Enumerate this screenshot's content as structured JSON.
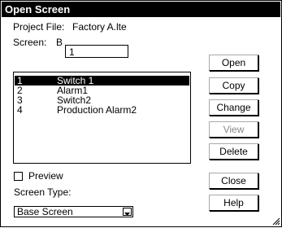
{
  "dialog": {
    "title": "Open Screen",
    "project_file_label": "Project File:",
    "project_file_value": "Factory A.lte",
    "screen_label": "Screen:",
    "screen_prefix": "B",
    "screen_value": "1",
    "screens": [
      {
        "number": "1",
        "name": "Switch 1",
        "selected": true
      },
      {
        "number": "2",
        "name": "Alarm1",
        "selected": false
      },
      {
        "number": "3",
        "name": "Switch2",
        "selected": false
      },
      {
        "number": "4",
        "name": "Production Alarm2",
        "selected": false
      }
    ],
    "preview_label": "Preview",
    "preview_checked": false,
    "screen_type_label": "Screen Type:",
    "screen_type_value": "Base Screen"
  },
  "buttons": {
    "open": "Open",
    "copy": "Copy",
    "change": "Change",
    "view": "View",
    "delete": "Delete",
    "close": "Close",
    "help": "Help"
  }
}
